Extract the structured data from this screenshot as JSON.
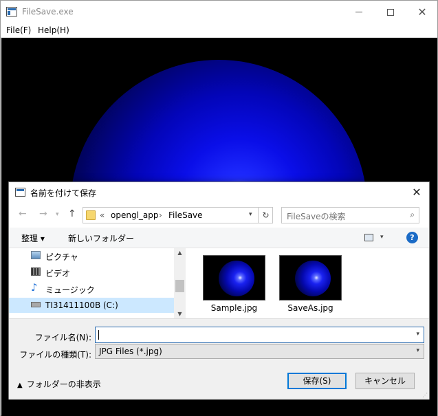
{
  "window": {
    "title": "FileSave.exe",
    "menu": {
      "file": "File(F)",
      "help": "Help(H)"
    }
  },
  "dialog": {
    "title": "名前を付けて保存",
    "address": {
      "overflow": "«",
      "part1": "opengl_app",
      "separator": "›",
      "part2": "FileSave"
    },
    "search_placeholder": "FileSaveの検索",
    "organize": "整理 ▾",
    "new_folder": "新しいフォルダー",
    "help_label": "?",
    "nav_items": [
      {
        "label": "ピクチャ",
        "icon": "pictures-icon"
      },
      {
        "label": "ビデオ",
        "icon": "video-icon"
      },
      {
        "label": "ミュージック",
        "icon": "music-icon"
      },
      {
        "label": "TI31411100B (C:)",
        "icon": "drive-icon",
        "selected": true
      }
    ],
    "files": [
      {
        "name": "Sample.jpg"
      },
      {
        "name": "SaveAs.jpg"
      }
    ],
    "filename_label": "ファイル名(N):",
    "filename_value": "",
    "filetype_label": "ファイルの種類(T):",
    "filetype_value": "JPG Files (*.jpg)",
    "hide_folders": "フォルダーの非表示",
    "save_button": "保存(S)",
    "cancel_button": "キャンセル"
  },
  "colors": {
    "sphere": "#0a0ee8",
    "background": "#000000",
    "accent": "#0078d7",
    "selection": "#cce8ff"
  }
}
